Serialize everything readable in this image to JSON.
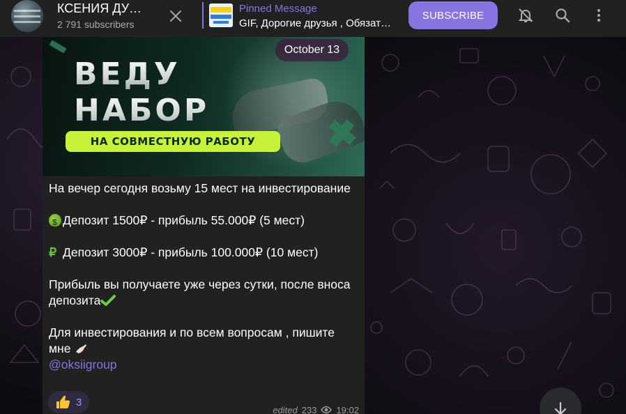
{
  "header": {
    "channel_title": "КСЕНИЯ ДУ…",
    "subscribers": "2 791 subscribers",
    "pinned_label": "Pinned Message",
    "pinned_text": "GIF, Дорогие друзья , Обязат…",
    "subscribe_label": "SUBSCRIBE",
    "icons": [
      "close-icon",
      "mute-bell-icon",
      "search-icon",
      "more-vertical-icon"
    ]
  },
  "message": {
    "date": "October 13",
    "media": {
      "line1": "ВЕДУ",
      "line2": "НАБОР",
      "pill": "НА СОВМЕСТНУЮ РАБОТУ"
    },
    "text": {
      "p1": "На вечер сегодня возьму 15 мест на инвестирование",
      "p2": "Депозит 1500₽ - прибыль 55.000₽ (5 мест)",
      "p3_symbol": "₽",
      "p3": "Депозит 3000₽ - прибыль 100.000₽ (10 мест)",
      "p4": "Прибыль вы получаете уже через сутки, после вноса депозита",
      "p5": "Для инвестирования и по всем вопросам , пишите мне",
      "link": "@oksiigroup"
    },
    "reaction": {
      "emoji": "👍",
      "count": "3"
    },
    "meta": {
      "edited": "edited",
      "views": "233",
      "time": "19:02"
    }
  },
  "colors": {
    "accent": "#8774e1",
    "header_bg": "#212121",
    "bubble_bg": "#212121",
    "banner_pill": "#c6f23a"
  }
}
